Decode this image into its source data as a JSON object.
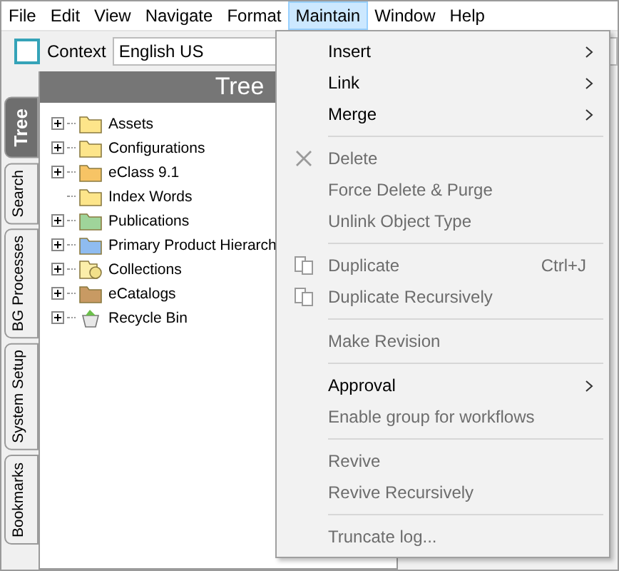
{
  "menubar": [
    {
      "label": "File",
      "selected": false
    },
    {
      "label": "Edit",
      "selected": false
    },
    {
      "label": "View",
      "selected": false
    },
    {
      "label": "Navigate",
      "selected": false
    },
    {
      "label": "Format",
      "selected": false
    },
    {
      "label": "Maintain",
      "selected": true
    },
    {
      "label": "Window",
      "selected": false
    },
    {
      "label": "Help",
      "selected": false
    }
  ],
  "context": {
    "label": "Context",
    "value": "English US"
  },
  "side_tabs": [
    {
      "label": "Tree",
      "selected": true
    },
    {
      "label": "Search",
      "selected": false
    },
    {
      "label": "BG Processes",
      "selected": false
    },
    {
      "label": "System Setup",
      "selected": false
    },
    {
      "label": "Bookmarks",
      "selected": false
    }
  ],
  "tree": {
    "title": "Tree",
    "items": [
      {
        "label": "Assets",
        "kind": "folder",
        "color": "#fde58a",
        "expandable": true
      },
      {
        "label": "Configurations",
        "kind": "folder",
        "color": "#fde58a",
        "expandable": true
      },
      {
        "label": "eClass 9.1",
        "kind": "folder",
        "color": "#f7c465",
        "expandable": true
      },
      {
        "label": "Index Words",
        "kind": "folder",
        "color": "#fde58a",
        "expandable": false
      },
      {
        "label": "Publications",
        "kind": "folder",
        "color": "#9fd49a",
        "expandable": true
      },
      {
        "label": "Primary Product Hierarch",
        "kind": "folder",
        "color": "#8fbcf0",
        "expandable": true
      },
      {
        "label": "Collections",
        "kind": "collection",
        "expandable": true
      },
      {
        "label": "eCatalogs",
        "kind": "folder",
        "color": "#c89a63",
        "expandable": true
      },
      {
        "label": "Recycle Bin",
        "kind": "recycle-bin",
        "expandable": true
      }
    ]
  },
  "menu": {
    "groups": [
      [
        {
          "label": "Insert",
          "disabled": false,
          "submenu": true
        },
        {
          "label": "Link",
          "disabled": false,
          "submenu": true
        },
        {
          "label": "Merge",
          "disabled": false,
          "submenu": true
        }
      ],
      [
        {
          "label": "Delete",
          "disabled": true,
          "submenu": false,
          "kind": "delete"
        },
        {
          "label": "Force Delete & Purge",
          "disabled": true,
          "submenu": false
        },
        {
          "label": "Unlink Object Type",
          "disabled": true,
          "submenu": false
        }
      ],
      [
        {
          "label": "Duplicate",
          "disabled": true,
          "submenu": false,
          "kind": "duplicate",
          "shortcut": "Ctrl+J"
        },
        {
          "label": "Duplicate Recursively",
          "disabled": true,
          "submenu": false,
          "kind": "duplicate"
        }
      ],
      [
        {
          "label": "Make Revision",
          "disabled": true,
          "submenu": false
        }
      ],
      [
        {
          "label": "Approval",
          "disabled": false,
          "submenu": true
        },
        {
          "label": "Enable group for workflows",
          "disabled": true,
          "submenu": false
        }
      ],
      [
        {
          "label": "Revive",
          "disabled": true,
          "submenu": false
        },
        {
          "label": "Revive Recursively",
          "disabled": true,
          "submenu": false
        }
      ],
      [
        {
          "label": "Truncate log...",
          "disabled": true,
          "submenu": false
        }
      ]
    ]
  }
}
